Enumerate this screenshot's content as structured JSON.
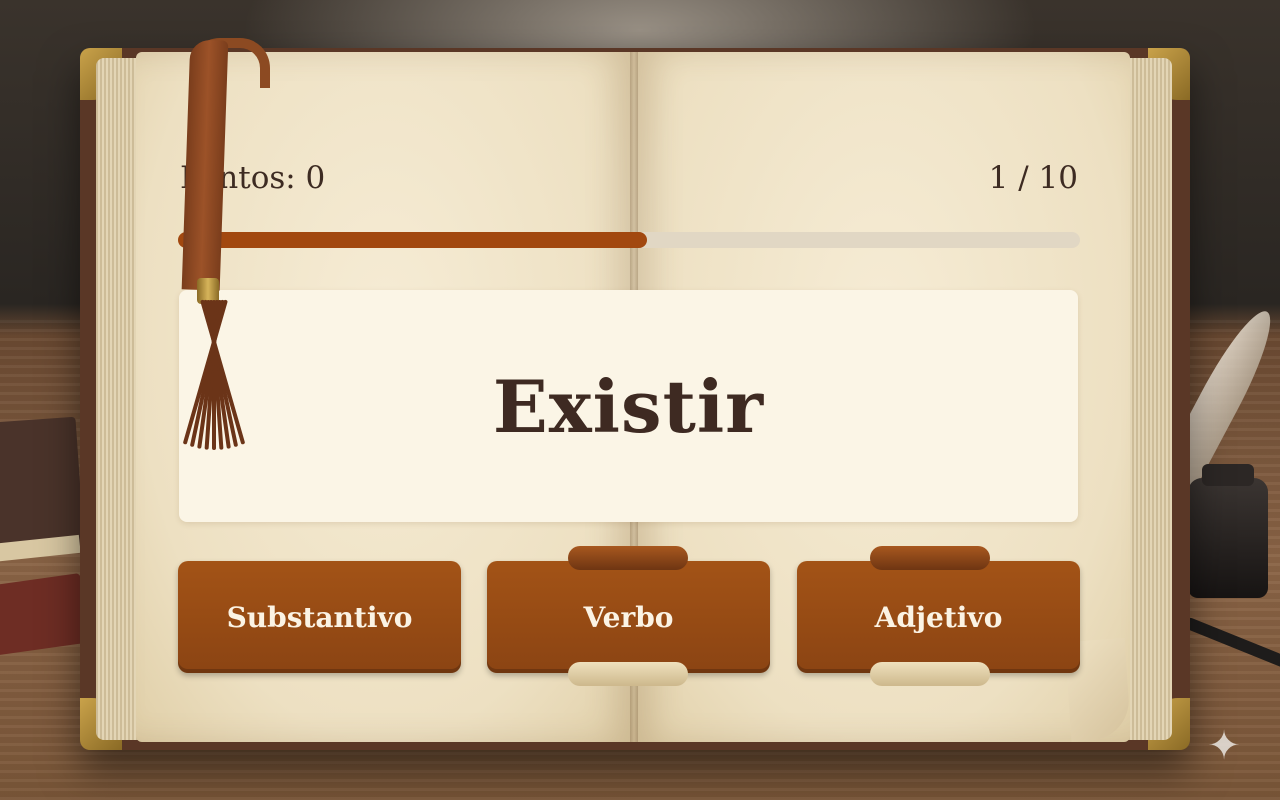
{
  "hud": {
    "score_label": "Pontos: 0",
    "question_counter": "1 / 10"
  },
  "progress": {
    "current": 1,
    "total": 10,
    "fill_fraction": 0.52
  },
  "question": {
    "word": "Existir"
  },
  "answers": [
    {
      "label": "Substantivo"
    },
    {
      "label": "Verbo"
    },
    {
      "label": "Adjetivo"
    }
  ],
  "colors": {
    "accent": "#a2480f",
    "button": "#9a4c14",
    "text_dark": "#3e2a22",
    "card": "#fbf5e6"
  },
  "icons": {
    "bookmark": "bookmark-ribbon-icon",
    "sparkle": "sparkle-icon"
  }
}
